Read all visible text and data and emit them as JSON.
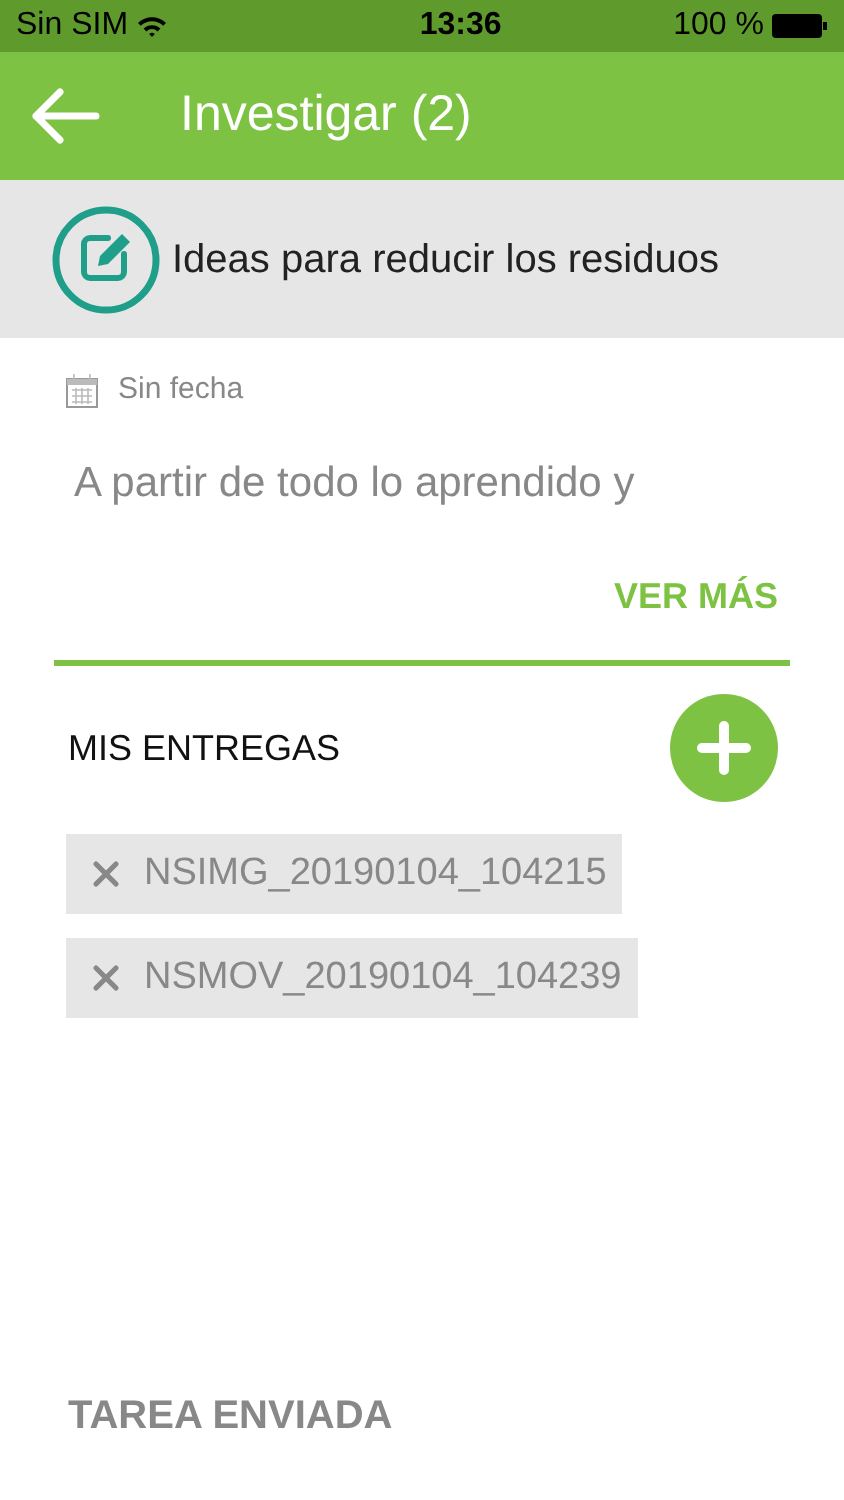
{
  "status_bar": {
    "carrier": "Sin SIM",
    "time": "13:36",
    "battery": "100 %"
  },
  "header": {
    "title": "Investigar (2)"
  },
  "task": {
    "title": "Ideas para reducir los residuos",
    "date": "Sin fecha",
    "description": "A partir de todo lo aprendido y",
    "more_link": "VER MÁS"
  },
  "deliveries": {
    "heading": "MIS ENTREGAS",
    "files": [
      {
        "name": "NSIMG_20190104_104215"
      },
      {
        "name": "NSMOV_20190104_104239"
      }
    ]
  },
  "footer": {
    "status": "TAREA ENVIADA"
  }
}
